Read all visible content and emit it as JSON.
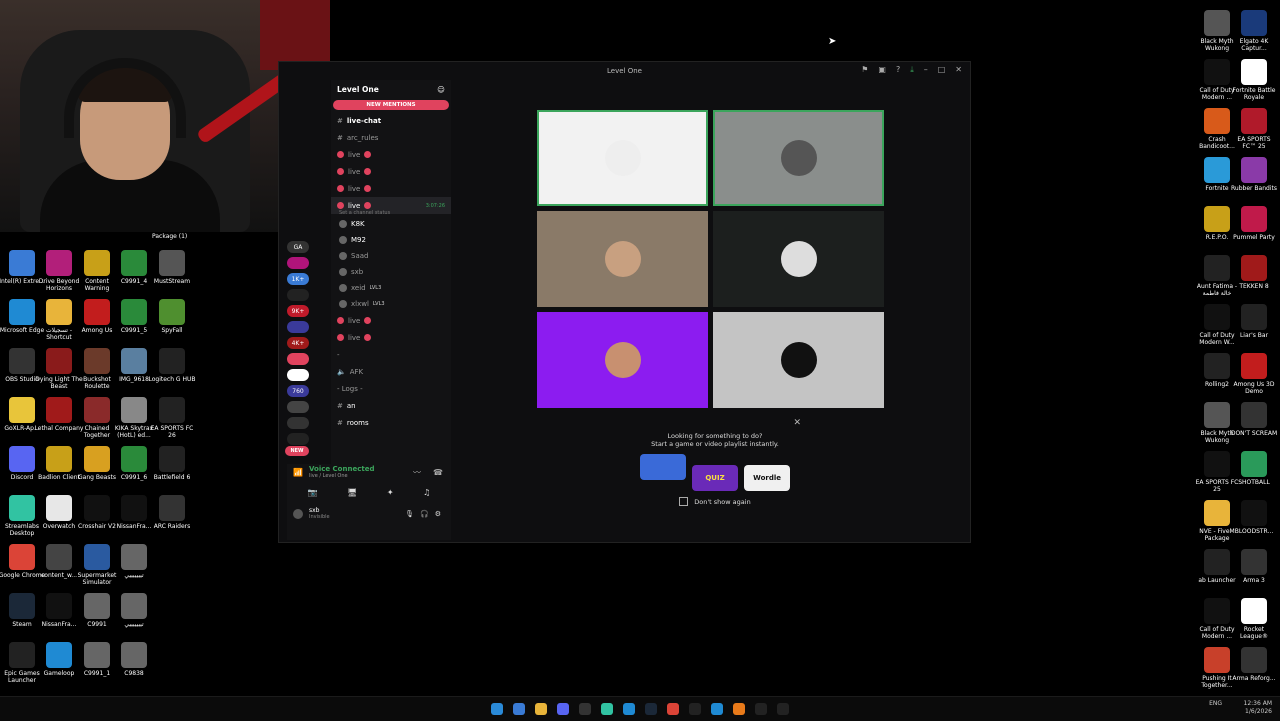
{
  "desktop": {
    "left_icons": [
      {
        "label": "Intel(R) Extre...",
        "color": "#3a7bd5"
      },
      {
        "label": "Drive Beyond Horizons",
        "color": "#b21f7a"
      },
      {
        "label": "Content Warning",
        "color": "#c8a018"
      },
      {
        "label": "C9991_4",
        "color": "#2a8a3a"
      },
      {
        "label": "MustStream",
        "color": "#555"
      },
      {
        "label": "Microsoft Edge",
        "color": "#1f8ad3"
      },
      {
        "label": "تسجيلات - Shortcut",
        "color": "#e8b43a"
      },
      {
        "label": "Among Us",
        "color": "#c21d1d"
      },
      {
        "label": "C9991_5",
        "color": "#2a8a3a"
      },
      {
        "label": "SpyFall",
        "color": "#4f8f2f"
      },
      {
        "label": "OBS Studio",
        "color": "#333"
      },
      {
        "label": "Dying Light The Beast",
        "color": "#8a1b1b"
      },
      {
        "label": "Buckshot Roulette",
        "color": "#6b3a2a"
      },
      {
        "label": "IMG_9618",
        "color": "#5a7fa0"
      },
      {
        "label": "Logitech G HUB",
        "color": "#222"
      },
      {
        "label": "GoXLR-Ap...",
        "color": "#e8c53a"
      },
      {
        "label": "Lethal Company",
        "color": "#a01a1a"
      },
      {
        "label": "Chained Together",
        "color": "#8a2a2a"
      },
      {
        "label": "KIKA Skytrax (HotL) ed...",
        "color": "#888"
      },
      {
        "label": "EA SPORTS FC 26",
        "color": "#222"
      },
      {
        "label": "Discord",
        "color": "#5865f2"
      },
      {
        "label": "Badlion Client",
        "color": "#c8a018"
      },
      {
        "label": "Gang Beasts",
        "color": "#d8a020"
      },
      {
        "label": "C9991_6",
        "color": "#2a8a3a"
      },
      {
        "label": "Battlefield 6",
        "color": "#222"
      },
      {
        "label": "Streamlabs Desktop",
        "color": "#31c3a2"
      },
      {
        "label": "Overwatch",
        "color": "#e7e7e7"
      },
      {
        "label": "Crosshair V2",
        "color": "#111"
      },
      {
        "label": "NissanFra...",
        "color": "#111"
      },
      {
        "label": "ARC Raiders",
        "color": "#333"
      },
      {
        "label": "Google Chrome",
        "color": "#db4437"
      },
      {
        "label": "content_w...",
        "color": "#444"
      },
      {
        "label": "Supermarket Simulator",
        "color": "#2a5aa0"
      },
      {
        "label": "تيييييييي",
        "color": "#666"
      },
      {
        "label": "",
        "color": "#000"
      },
      {
        "label": "Steam",
        "color": "#1b2838"
      },
      {
        "label": "NissanFra...",
        "color": "#111"
      },
      {
        "label": "C9991",
        "color": "#666"
      },
      {
        "label": "تيييييييي",
        "color": "#666"
      },
      {
        "label": "",
        "color": "#000"
      },
      {
        "label": "Epic Games Launcher",
        "color": "#222"
      },
      {
        "label": "Gameloop",
        "color": "#1f8ad3"
      },
      {
        "label": "C9991_1",
        "color": "#666"
      },
      {
        "label": "C9838",
        "color": "#666"
      },
      {
        "label": "",
        "color": "#000"
      }
    ],
    "right_icons": [
      {
        "label": "Black Myth Wukong",
        "color": "#555"
      },
      {
        "label": "Elgato 4K Captur...",
        "color": "#1a3a7a"
      },
      {
        "label": "Call of Duty Modern ...",
        "color": "#111"
      },
      {
        "label": "Fortnite Battle Royale",
        "color": "#fff"
      },
      {
        "label": "Crash Bandicoot...",
        "color": "#d85a1a"
      },
      {
        "label": "EA SPORTS FC™ 25",
        "color": "#b01a2a"
      },
      {
        "label": "Fortnite",
        "color": "#2a9ad8"
      },
      {
        "label": "Rubber Bandits",
        "color": "#8a3aa8"
      },
      {
        "label": "R.E.P.O.",
        "color": "#c8a018"
      },
      {
        "label": "Pummel Party",
        "color": "#c01a4a"
      },
      {
        "label": "Aunt Fatima - خالة فاطمة",
        "color": "#222"
      },
      {
        "label": "TEKKEN 8",
        "color": "#a01a1a"
      },
      {
        "label": "Call of Duty Modern W...",
        "color": "#111"
      },
      {
        "label": "Liar's Bar",
        "color": "#222"
      },
      {
        "label": "Rolling2",
        "color": "#222"
      },
      {
        "label": "Among Us 3D Demo",
        "color": "#c21d1d"
      },
      {
        "label": "Black Myth Wukong",
        "color": "#555"
      },
      {
        "label": "DON'T SCREAM",
        "color": "#333"
      },
      {
        "label": "EA SPORTS FC 25",
        "color": "#111"
      },
      {
        "label": "SHOTBALL",
        "color": "#2a9a5a"
      },
      {
        "label": "NVE - FiveM Package",
        "color": "#e8b43a"
      },
      {
        "label": "BLOODSTR...",
        "color": "#111"
      },
      {
        "label": "ab Launcher",
        "color": "#222"
      },
      {
        "label": "Arma 3",
        "color": "#333"
      },
      {
        "label": "Call of Duty Modern ...",
        "color": "#111"
      },
      {
        "label": "Rocket League®",
        "color": "#fff"
      },
      {
        "label": "Pushing It Together...",
        "color": "#c8402a"
      },
      {
        "label": "Arma Reforg...",
        "color": "#333"
      }
    ],
    "package_label": "Package (1)"
  },
  "window": {
    "title": "Level One",
    "server_name": "Level One",
    "new_mentions": "NEW MENTIONS",
    "channels": [
      {
        "name": "live-chat",
        "kind": "text"
      },
      {
        "name": "arc_rules",
        "kind": "text"
      },
      {
        "name": "live",
        "kind": "live"
      },
      {
        "name": "live",
        "kind": "live"
      },
      {
        "name": "live",
        "kind": "live"
      },
      {
        "name": "live",
        "kind": "live",
        "active": true,
        "timer": "3:07:26"
      }
    ],
    "status_placeholder": "Set a channel status",
    "voice_users": [
      {
        "name": "K8K"
      },
      {
        "name": "M92"
      },
      {
        "name": "Saad"
      },
      {
        "name": "sxb"
      },
      {
        "name": "xeid",
        "badge": "LVL3"
      },
      {
        "name": "xlxwl",
        "badge": "LVL3"
      }
    ],
    "more_channels": [
      {
        "name": "live",
        "kind": "live"
      },
      {
        "name": "live",
        "kind": "live"
      },
      {
        "name": "-",
        "kind": "divider"
      },
      {
        "name": "AFK",
        "kind": "voice"
      },
      {
        "name": "- Logs -",
        "kind": "category"
      },
      {
        "name": "an",
        "kind": "text"
      },
      {
        "name": "rooms",
        "kind": "text"
      }
    ],
    "new_badge": "NEW",
    "voice_connected": "Voice Connected",
    "voice_sub": "live / Level One",
    "user_name": "sxb",
    "user_status": "Invisible",
    "server_badges": [
      "GA",
      "",
      "1K+",
      "",
      "9K+",
      "",
      "4K+",
      "",
      "",
      "760",
      "",
      "",
      ""
    ],
    "tiles": [
      {
        "bg": "#f2f2f2",
        "avatar": "#eeeeee",
        "speaking": true
      },
      {
        "bg": "#8a8e8c",
        "avatar": "#555",
        "speaking": true
      },
      {
        "bg": "#8a7a68",
        "avatar": "#c8a080",
        "speaking": false
      },
      {
        "bg": "#1c1f1e",
        "avatar": "#ddd",
        "speaking": false
      },
      {
        "bg": "#8c1cf0",
        "avatar": "#c89070",
        "speaking": false
      },
      {
        "bg": "#c4c4c4",
        "avatar": "#111",
        "speaking": false
      }
    ],
    "prompt": {
      "title": "Looking for something to do?",
      "subtitle": "Start a game or video playlist instantly.",
      "activities": [
        "",
        "QUIZ",
        "Wordle"
      ],
      "checkbox_label": "Don't show again"
    }
  },
  "taskbar": {
    "lang": "ENG",
    "time": "12:36 AM",
    "date": "1/6/2026"
  }
}
